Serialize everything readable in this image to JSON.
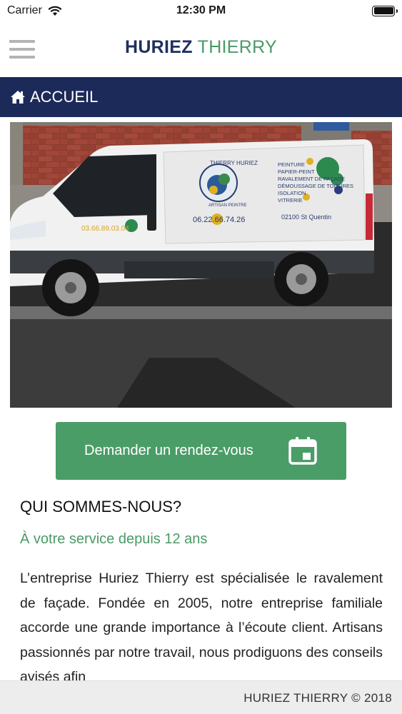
{
  "status_bar": {
    "carrier": "Carrier",
    "time": "12:30 PM"
  },
  "header": {
    "brand_first": "HURIEZ",
    "brand_second": "THIERRY",
    "menu_icon": "hamburger-menu-icon"
  },
  "nav": {
    "icon": "home-icon",
    "title": "ACCUEIL"
  },
  "hero": {
    "van_text": {
      "brand_line1": "THIERRY HURIEZ",
      "brand_line2": "ARTISAN PEINTRE",
      "services": [
        "PEINTURE",
        "PAPIER-PEINT",
        "RAVALEMENT DE FAÇADE",
        "DÉMOUSSAGE DE TOITURES",
        "ISOLATION",
        "VITRERIE"
      ],
      "phone_door": "03.66.89.03.04",
      "phone_side": "06.22.66.74.26",
      "city": "02100 St Quentin"
    }
  },
  "cta": {
    "label": "Demander un rendez-vous",
    "icon": "calendar-icon"
  },
  "about": {
    "title": "QUI SOMMES-NOUS?",
    "subtitle": "À votre service depuis 12 ans",
    "body": "L’entreprise Huriez Thierry est spécialisée le ravalement de façade. Fondée en 2005, notre entreprise familiale accorde une grande importance à l’écoute client. Artisans passionnés par notre travail, nous prodiguons des conseils avisés afin"
  },
  "footer": {
    "text": "HURIEZ THIERRY © 2018"
  },
  "colors": {
    "navy": "#1c2a5a",
    "green": "#4a9d67",
    "footer_bg": "#ededed"
  }
}
